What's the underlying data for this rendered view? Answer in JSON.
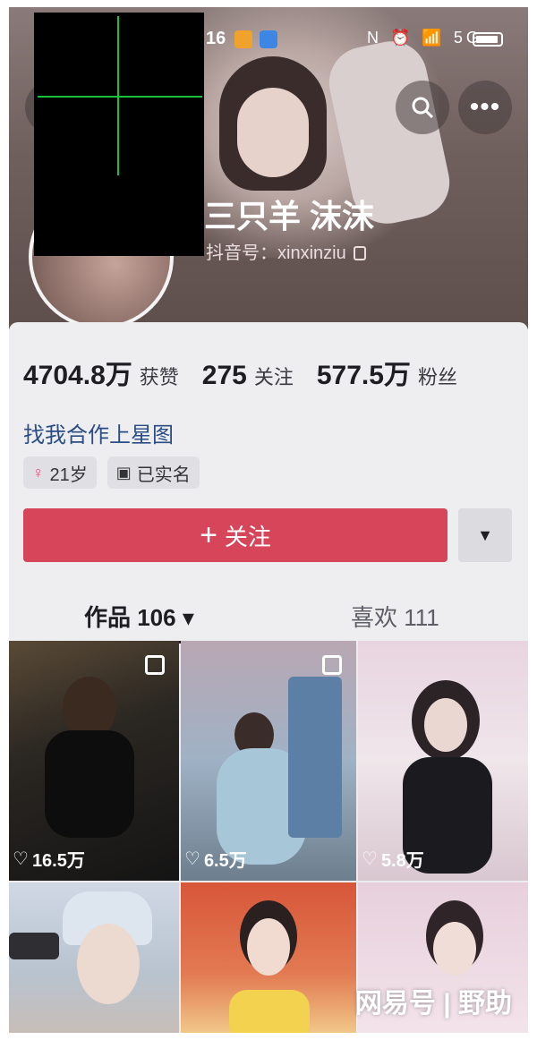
{
  "status_bar": {
    "time": "16",
    "icons": "N ⏰ 📶 5G",
    "battery": "battery-icon"
  },
  "header": {
    "back_icon": "back-arrow-icon",
    "search_icon": "search-icon",
    "more_label": "•••",
    "name": "三只羊 沫沫",
    "douyin_id": "抖音号：xinxinziu"
  },
  "stats": [
    {
      "value": "4704.8万",
      "label": "获赞"
    },
    {
      "value": "275",
      "label": "关注"
    },
    {
      "value": "577.5万",
      "label": "粉丝"
    }
  ],
  "bio_link": "找我合作上星图",
  "tags": [
    {
      "icon": "female-icon",
      "glyph": "♀",
      "text": "21岁"
    },
    {
      "icon": "id-card-icon",
      "glyph": "▣",
      "text": "已实名"
    }
  ],
  "follow_button": {
    "plus": "+",
    "label": "关注"
  },
  "dropdown_glyph": "▼",
  "tabs": {
    "works": "作品 106 ▾",
    "likes": "喜欢 111"
  },
  "videos": [
    {
      "likes": "16.5万"
    },
    {
      "likes": "6.5万"
    },
    {
      "likes": "5.8万"
    }
  ],
  "watermark": "网易号 | 野助"
}
